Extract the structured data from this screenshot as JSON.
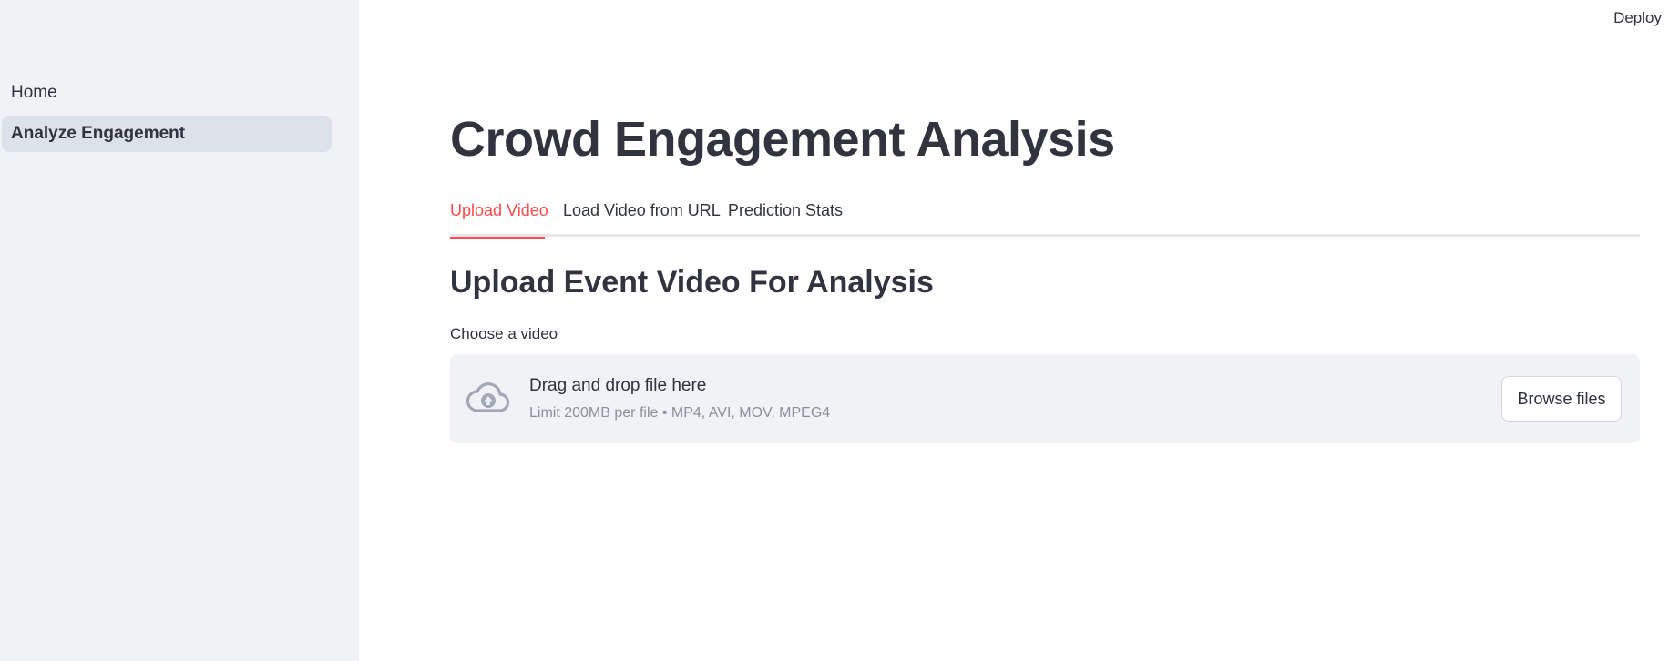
{
  "sidebar": {
    "items": [
      {
        "label": "Home",
        "active": false
      },
      {
        "label": "Analyze Engagement",
        "active": true
      }
    ]
  },
  "header": {
    "deploy_label": "Deploy"
  },
  "main": {
    "title": "Crowd Engagement Analysis",
    "tabs": [
      {
        "label": "Upload Video",
        "active": true
      },
      {
        "label": "Load Video from URL",
        "active": false
      },
      {
        "label": "Prediction Stats",
        "active": false
      }
    ],
    "section_heading": "Upload Event Video For Analysis",
    "uploader": {
      "label": "Choose a video",
      "title": "Drag and drop file here",
      "limits": "Limit 200MB per file • MP4, AVI, MOV, MPEG4",
      "browse_label": "Browse files",
      "icon": "cloud-upload-icon"
    }
  },
  "colors": {
    "accent": "#ff4b4b",
    "sidebar_bg": "#f0f2f6",
    "active_nav_bg": "#dde1e9",
    "text": "#31333f",
    "muted_text": "#8c8f99"
  }
}
